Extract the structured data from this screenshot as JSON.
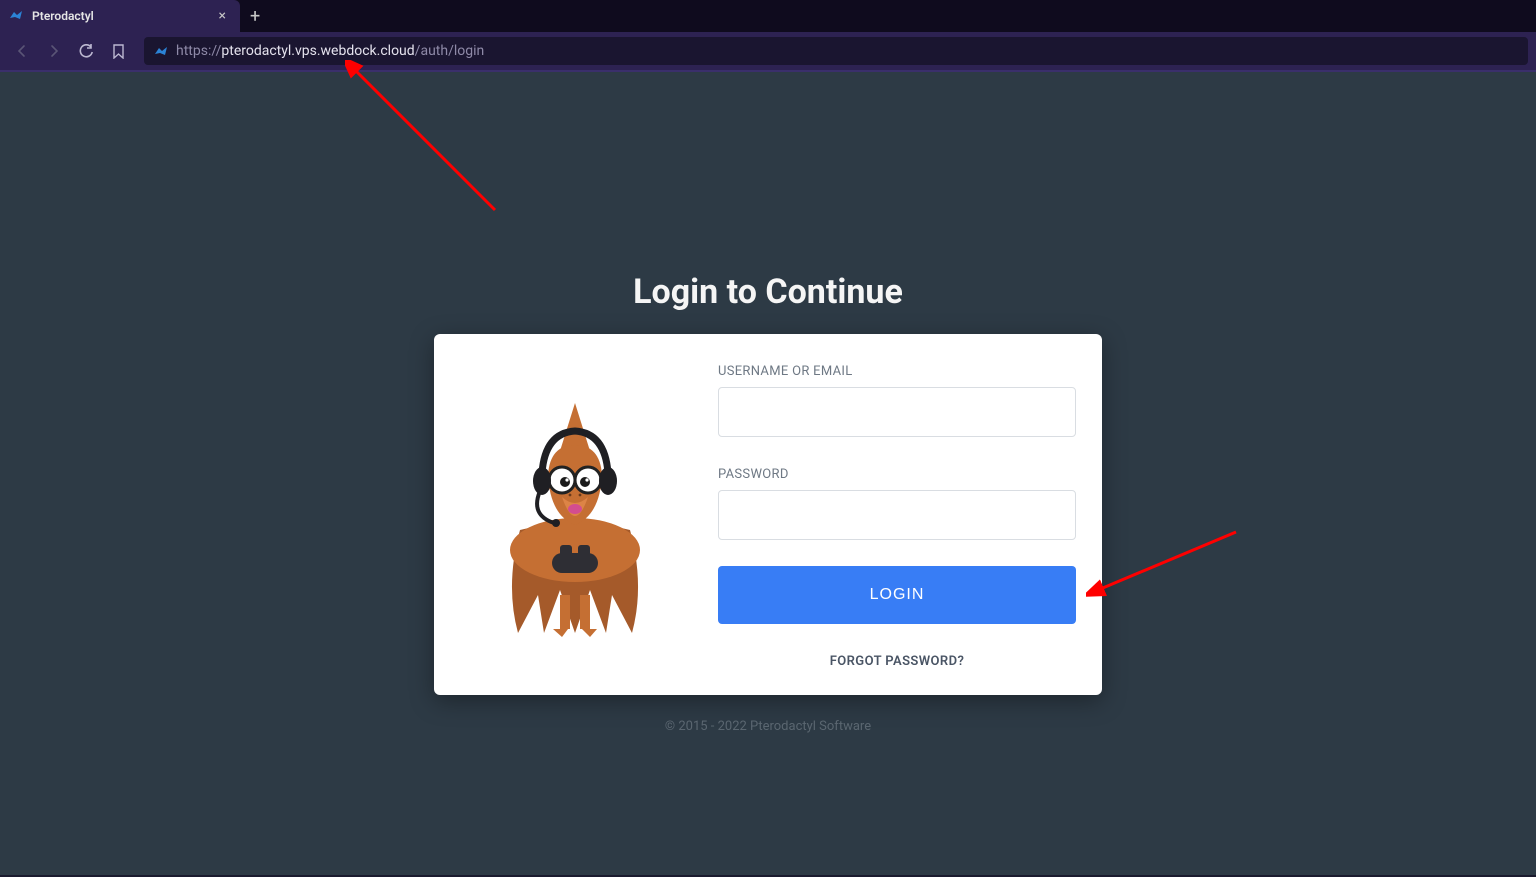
{
  "browser": {
    "tab_title": "Pterodactyl",
    "url_scheme": "https://",
    "url_host": "pterodactyl.vps.webdock.cloud",
    "url_path": "/auth/login"
  },
  "page": {
    "heading": "Login to Continue",
    "username_label": "USERNAME OR EMAIL",
    "password_label": "PASSWORD",
    "login_button": "LOGIN",
    "forgot_password": "FORGOT PASSWORD?",
    "copyright": "© 2015 - 2022 Pterodactyl Software"
  },
  "colors": {
    "page_bg": "#2d3a45",
    "card_bg": "#ffffff",
    "button_bg": "#387df5",
    "chrome_tab": "#2d2252",
    "arrow": "#ff0000"
  }
}
